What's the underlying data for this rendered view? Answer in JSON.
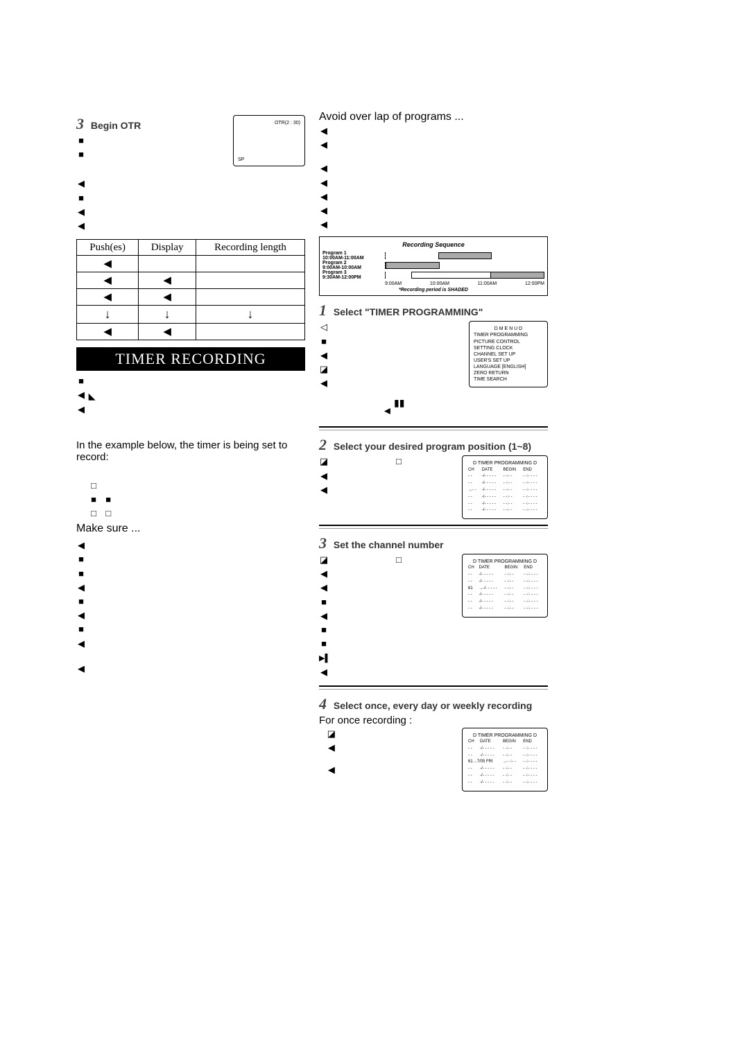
{
  "left": {
    "step3": {
      "num": "3",
      "title": "Begin OTR",
      "osd_top": "OTR(2 : 30)",
      "osd_bottom": "SP"
    },
    "pushes_table": {
      "h1": "Push(es)",
      "h2": "Display",
      "h3": "Recording length"
    },
    "banner": "TIMER RECORDING",
    "example_line": "In the example below, the timer is being set to record:",
    "makesure": "Make sure ..."
  },
  "right": {
    "avoid": "Avoid over lap of programs ...",
    "timeline": {
      "title": "Recording Sequence",
      "p1": "Program 1",
      "p1t": "10:00AM-11:00AM",
      "p2": "Program 2",
      "p2t": "9:00AM-10:00AM",
      "p3": "Program 3",
      "p3t": "9:30AM-12:00PM",
      "t1": "9:00AM",
      "t2": "10:00AM",
      "t3": "11:00AM",
      "t4": "12:00PM",
      "note": "*Recording period is SHADED"
    },
    "step1": {
      "num": "1",
      "title": "Select \"TIMER PROGRAMMING\""
    },
    "menu": {
      "title": "D M E N U D",
      "items": [
        "TIMER PROGRAMMING",
        "PICTURE CONTROL",
        "SETTING CLOCK",
        "CHANNEL SET UP",
        "USER'S SET UP",
        "LANGUAGE  [ENGLISH]",
        "ZERO RETURN",
        "TIME SEARCH"
      ]
    },
    "step2": {
      "num": "2",
      "title": "Select your desired program position (1~8)"
    },
    "timer_table": {
      "title": "D TIMER PROGRAMMING D",
      "h1": "CH",
      "h2": "DATE",
      "h3": "BEGIN",
      "h4": "END"
    },
    "step3": {
      "num": "3",
      "title": "Set the channel number",
      "row3_ch": "61"
    },
    "step4": {
      "num": "4",
      "title": "Select once, every day or weekly recording",
      "sub": "For once recording :",
      "row3": "61→7/05  FRI"
    }
  }
}
